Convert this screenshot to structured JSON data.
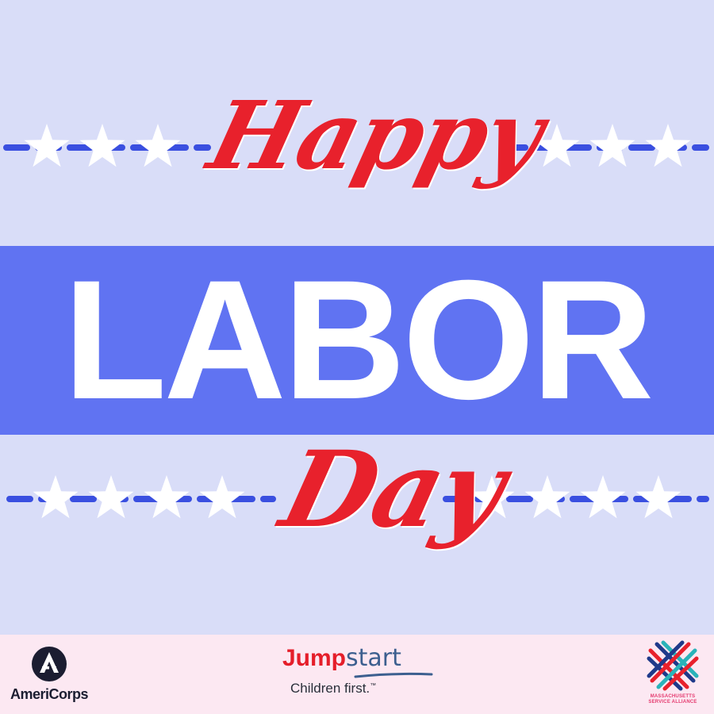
{
  "greeting": {
    "line1": "Happy",
    "line2": "LABOR",
    "line3": "Day"
  },
  "colors": {
    "background": "#d9ddf8",
    "band": "#6073f2",
    "script_red": "#e8212c",
    "labor_white": "#ffffff",
    "star_white": "#ffffff",
    "dash_blue": "#3a4fe0",
    "footer": "#fce8f2"
  },
  "decorations": {
    "top_stars_per_side": 3,
    "bottom_stars_per_side": 4,
    "star_icon": "star-icon"
  },
  "footer": {
    "logos": {
      "americorps": {
        "name": "AmeriCorps",
        "icon": "americorps-a-icon"
      },
      "jumpstart": {
        "name_part1": "Jump",
        "name_part2": "start",
        "tagline": "Children first.",
        "trademark": "™"
      },
      "msa": {
        "line1": "MASSACHUSETTS",
        "line2": "SERVICE ALLIANCE",
        "icon": "woven-mark-icon"
      }
    }
  }
}
